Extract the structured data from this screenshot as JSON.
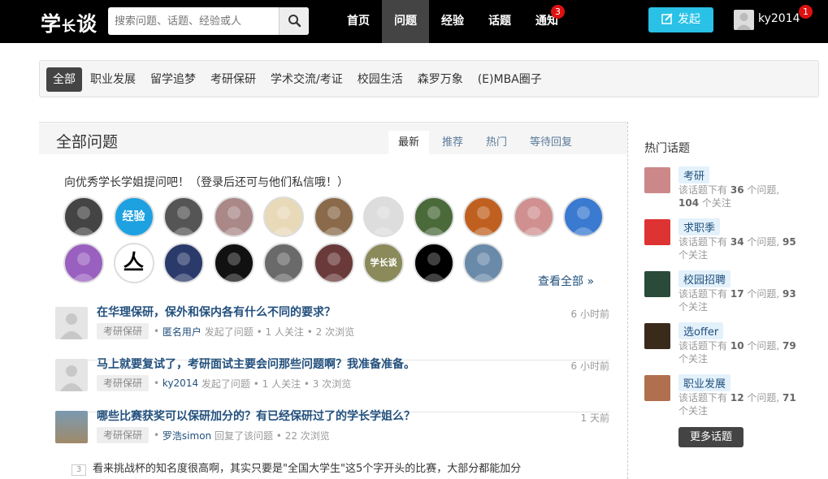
{
  "header": {
    "logo_main": "学",
    "logo_small": "长",
    "logo_end": "谈",
    "search_placeholder": "搜索问题、话题、经验或人",
    "search_icon": "search-icon",
    "nav": [
      {
        "label": "首页",
        "active": false
      },
      {
        "label": "问题",
        "active": true
      },
      {
        "label": "经验",
        "active": false
      },
      {
        "label": "话题",
        "active": false
      },
      {
        "label": "通知",
        "active": false,
        "badge": "3"
      }
    ],
    "post_button": "发起",
    "username": "ky2014",
    "user_badge": "1"
  },
  "categories": [
    "全部",
    "职业发展",
    "留学追梦",
    "考研保研",
    "学术交流/考证",
    "校园生活",
    "森罗万象",
    "(E)MBA圈子"
  ],
  "active_category": "全部",
  "main": {
    "title": "全部问题",
    "tabs": [
      "最新",
      "推荐",
      "热门",
      "等待回复"
    ],
    "active_tab": "最新",
    "invite_text": "向优秀学长学姐提问吧！（登录后还可与他们私信哦！）",
    "view_all": "查看全部 »",
    "avatar_colors": [
      "#444",
      "#1da1e0",
      "#555",
      "#a88",
      "#e8d9b8",
      "#8a6a4a",
      "#ddd",
      "#4a6a3a",
      "#c06020",
      "#d09090",
      "#3a7ad0",
      "#9a60c0",
      "#3a6a9a",
      "#2a3a6a",
      "#111",
      "#6a6a6a",
      "#6a3a3a",
      "#8a8a5a",
      "#000",
      "#6a8aaa"
    ],
    "avatar_glyphs": {
      "1": "经验",
      "12": "亼",
      "17": "学长谈"
    },
    "questions": [
      {
        "title": "在华理保研，保外和保内各有什么不同的要求？",
        "tag": "考研保研",
        "user": "匿名用户",
        "action": "发起了问题 • 1 人关注 • 2 次浏览",
        "time": "6 小时前"
      },
      {
        "title": "马上就要复试了，考研面试主要会问那些问题啊？我准备准备。",
        "tag": "考研保研",
        "user": "ky2014",
        "action": "发起了问题 • 1 人关注 • 3 次浏览",
        "time": "6 小时前"
      },
      {
        "title": "哪些比赛获奖可以保研加分的？有已经保研过了的学长学姐么？",
        "tag": "考研保研",
        "user": "罗浩simon",
        "action": "回复了该问题 • 22 次浏览",
        "time": "1 天前"
      }
    ],
    "excerpt_num": "3",
    "excerpt": "看来挑战杯的知名度很高啊，其实只要是\"全国大学生\"这5个字开头的比赛，大部分都能加分"
  },
  "sidebar": {
    "title": "热门话题",
    "topics": [
      {
        "name": "考研",
        "line1": "该话题下有",
        "count": "36",
        "line2": "个问题,",
        "followers": "104",
        "line3": "个关注"
      },
      {
        "name": "求职季",
        "line1": "该话题下有",
        "count": "34",
        "line2": "个问题,",
        "followers": "95",
        "line3": "个关注"
      },
      {
        "name": "校园招聘",
        "line1": "该话题下有",
        "count": "17",
        "line2": "个问题,",
        "followers": "93",
        "line3": "个关注"
      },
      {
        "name": "选offer",
        "line1": "该话题下有",
        "count": "10",
        "line2": "个问题,",
        "followers": "79",
        "line3": "个关注"
      },
      {
        "name": "职业发展",
        "line1": "该话题下有",
        "count": "12",
        "line2": "个问题,",
        "followers": "71",
        "line3": "个关注"
      }
    ],
    "topic_colors": [
      "#c88",
      "#d33",
      "#2a4a3a",
      "#3a2a1a",
      "#b07050"
    ],
    "more_button": "更多话题"
  }
}
